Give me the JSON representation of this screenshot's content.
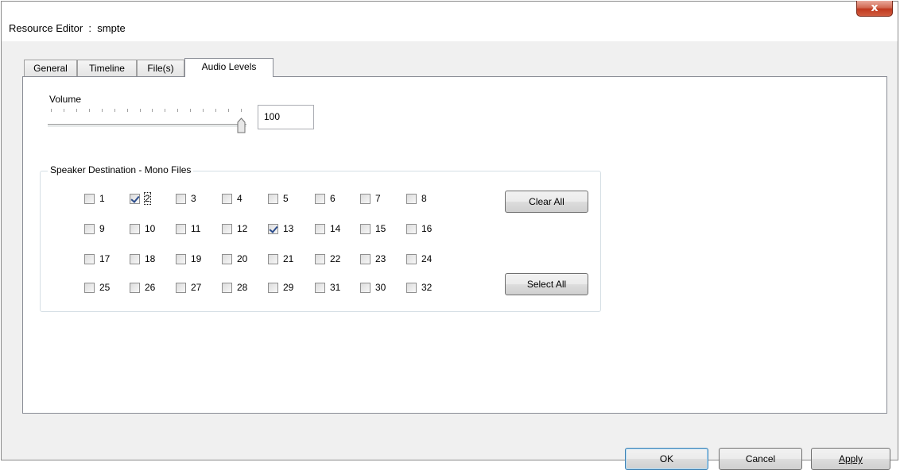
{
  "window": {
    "title": "Resource Editor  :  smpte",
    "close_label": "x"
  },
  "tabs": [
    {
      "label": "General",
      "active": false
    },
    {
      "label": "Timeline",
      "active": false
    },
    {
      "label": "File(s)",
      "active": false
    },
    {
      "label": "Audio Levels",
      "active": true
    }
  ],
  "volume": {
    "label": "Volume",
    "value": "100",
    "level_fraction": 1.0
  },
  "speaker_group": {
    "title": "Speaker Destination - Mono Files",
    "rows": [
      [
        {
          "label": "1",
          "checked": false
        },
        {
          "label": "2",
          "checked": true
        },
        {
          "label": "3",
          "checked": false
        },
        {
          "label": "4",
          "checked": false
        },
        {
          "label": "5",
          "checked": false
        },
        {
          "label": "6",
          "checked": false
        },
        {
          "label": "7",
          "checked": false
        },
        {
          "label": "8",
          "checked": false
        }
      ],
      [
        {
          "label": "9",
          "checked": false
        },
        {
          "label": "10",
          "checked": false
        },
        {
          "label": "11",
          "checked": false
        },
        {
          "label": "12",
          "checked": false
        },
        {
          "label": "13",
          "checked": true
        },
        {
          "label": "14",
          "checked": false
        },
        {
          "label": "15",
          "checked": false
        },
        {
          "label": "16",
          "checked": false
        }
      ],
      [
        {
          "label": "17",
          "checked": false
        },
        {
          "label": "18",
          "checked": false
        },
        {
          "label": "19",
          "checked": false
        },
        {
          "label": "20",
          "checked": false
        },
        {
          "label": "21",
          "checked": false
        },
        {
          "label": "22",
          "checked": false
        },
        {
          "label": "23",
          "checked": false
        },
        {
          "label": "24",
          "checked": false
        }
      ],
      [
        {
          "label": "25",
          "checked": false
        },
        {
          "label": "26",
          "checked": false
        },
        {
          "label": "27",
          "checked": false
        },
        {
          "label": "28",
          "checked": false
        },
        {
          "label": "29",
          "checked": false
        },
        {
          "label": "31",
          "checked": false
        },
        {
          "label": "30",
          "checked": false
        },
        {
          "label": "32",
          "checked": false
        }
      ]
    ],
    "clear_all_label": "Clear All",
    "select_all_label": "Select All"
  },
  "footer": {
    "ok_label": "OK",
    "cancel_label": "Cancel",
    "apply_label": "Apply"
  }
}
